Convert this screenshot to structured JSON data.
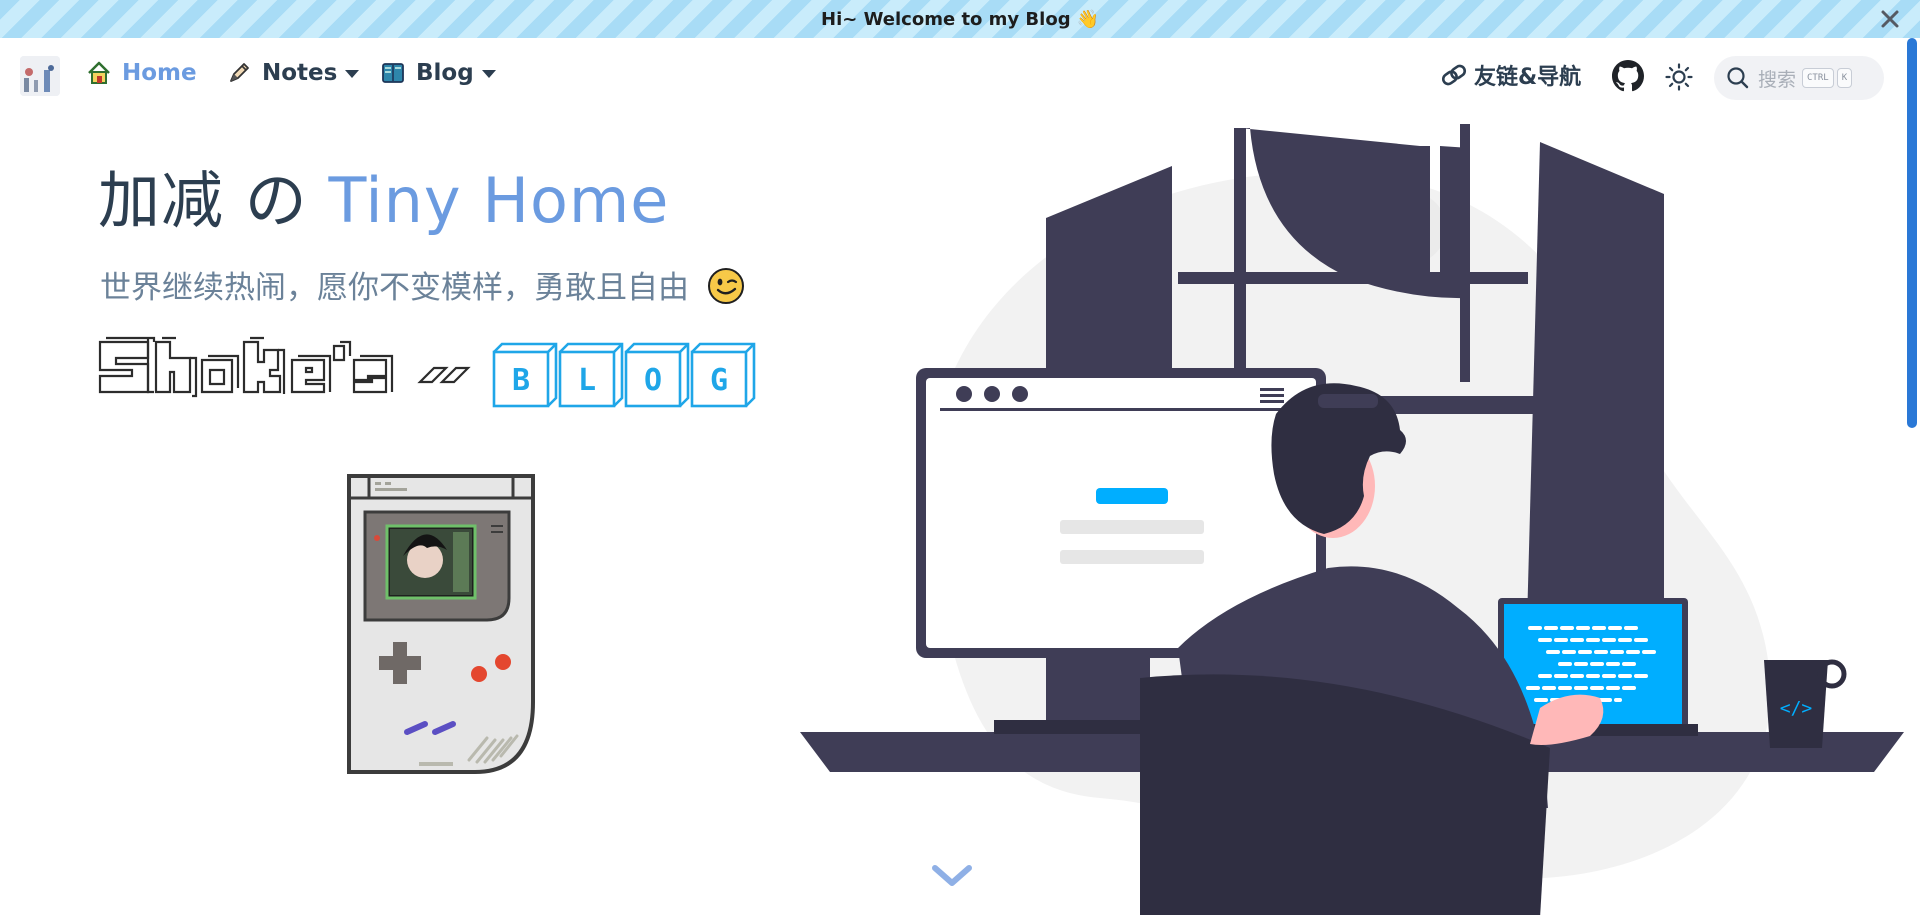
{
  "banner": {
    "text": "Hi~ Welcome to my Blog",
    "emoji": "👋"
  },
  "navbar": {
    "logo_icon": "site-logo-icon",
    "items": [
      {
        "label": "Home",
        "icon": "home-icon",
        "active": true
      },
      {
        "label": "Notes",
        "icon": "pen-icon",
        "dropdown": true
      },
      {
        "label": "Blog",
        "icon": "book-icon",
        "dropdown": true
      }
    ],
    "friend_link": "友链&导航",
    "search": {
      "placeholder": "搜索",
      "shortcut": [
        "CTRL",
        "K"
      ]
    }
  },
  "hero": {
    "title_main": "加减 の",
    "title_accent": "Tiny Home",
    "tagline": "世界继续热闹，愿你不变模样，勇敢且自由",
    "tagline_emoji": "😉",
    "pixel_logo_letters": [
      "B",
      "L",
      "O",
      "G"
    ]
  },
  "colors": {
    "accent": "#6b9be0",
    "text": "#2c3e50",
    "subtext": "#6b8299",
    "illustration_dark": "#3f3d56",
    "illustration_blue": "#00aeff",
    "scrollbar": "#2a78d6"
  }
}
